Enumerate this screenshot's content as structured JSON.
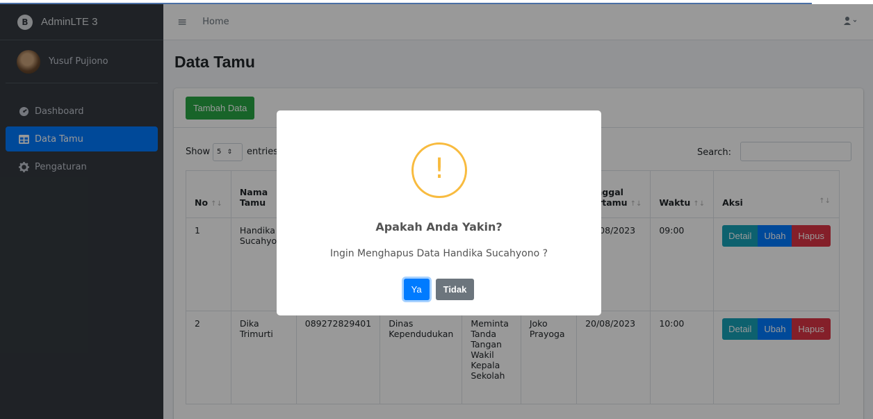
{
  "brand": {
    "title": "AdminLTE 3",
    "logo_letter": "B"
  },
  "user": {
    "name": "Yusuf Pujiono"
  },
  "sidebar": {
    "items": [
      {
        "label": "Dashboard",
        "icon": "dashboard-icon",
        "active": false
      },
      {
        "label": "Data Tamu",
        "icon": "table-icon",
        "active": true
      },
      {
        "label": "Pengaturan",
        "icon": "gear-icon",
        "active": false
      }
    ]
  },
  "navbar": {
    "menu_icon": "≡",
    "home_label": "Home",
    "user_icon": "user-icon"
  },
  "page": {
    "title": "Data Tamu"
  },
  "card": {
    "add_button": "Tambah Data"
  },
  "controls": {
    "show_label": "Show",
    "page_size": "5",
    "entries_label": "entries",
    "search_label": "Search:"
  },
  "table": {
    "headers": [
      "No",
      "Nama Tamu",
      "",
      "",
      "",
      "",
      "Tanggal Bertamu",
      "Waktu",
      "Aksi"
    ],
    "rows": [
      {
        "no": "1",
        "nama": "Handika Sucahyono",
        "hp": "",
        "instansi": "",
        "keperluan": "",
        "tujuan": "",
        "tanggal": "20/08/2023",
        "waktu": "09:00"
      },
      {
        "no": "2",
        "nama": "Dika Trimurti",
        "hp": "089272829401",
        "instansi": "Dinas Kependudukan",
        "keperluan": "Meminta Tanda Tangan Wakil Kepala Sekolah",
        "tujuan": "Joko Prayoga",
        "tanggal": "20/08/2023",
        "waktu": "10:00"
      }
    ],
    "actions": {
      "detail": "Detail",
      "edit": "Ubah",
      "delete": "Hapus"
    }
  },
  "modal": {
    "icon": "!",
    "title": "Apakah Anda Yakin?",
    "text": "Ingin Menghapus Data Handika Sucahyono ?",
    "confirm": "Ya",
    "cancel": "Tidak"
  },
  "colors": {
    "sidebar": "#343a40",
    "primary": "#007bff",
    "success": "#28a745",
    "info": "#17a2b8",
    "danger": "#dc3545",
    "warning": "#f8bb3f"
  }
}
